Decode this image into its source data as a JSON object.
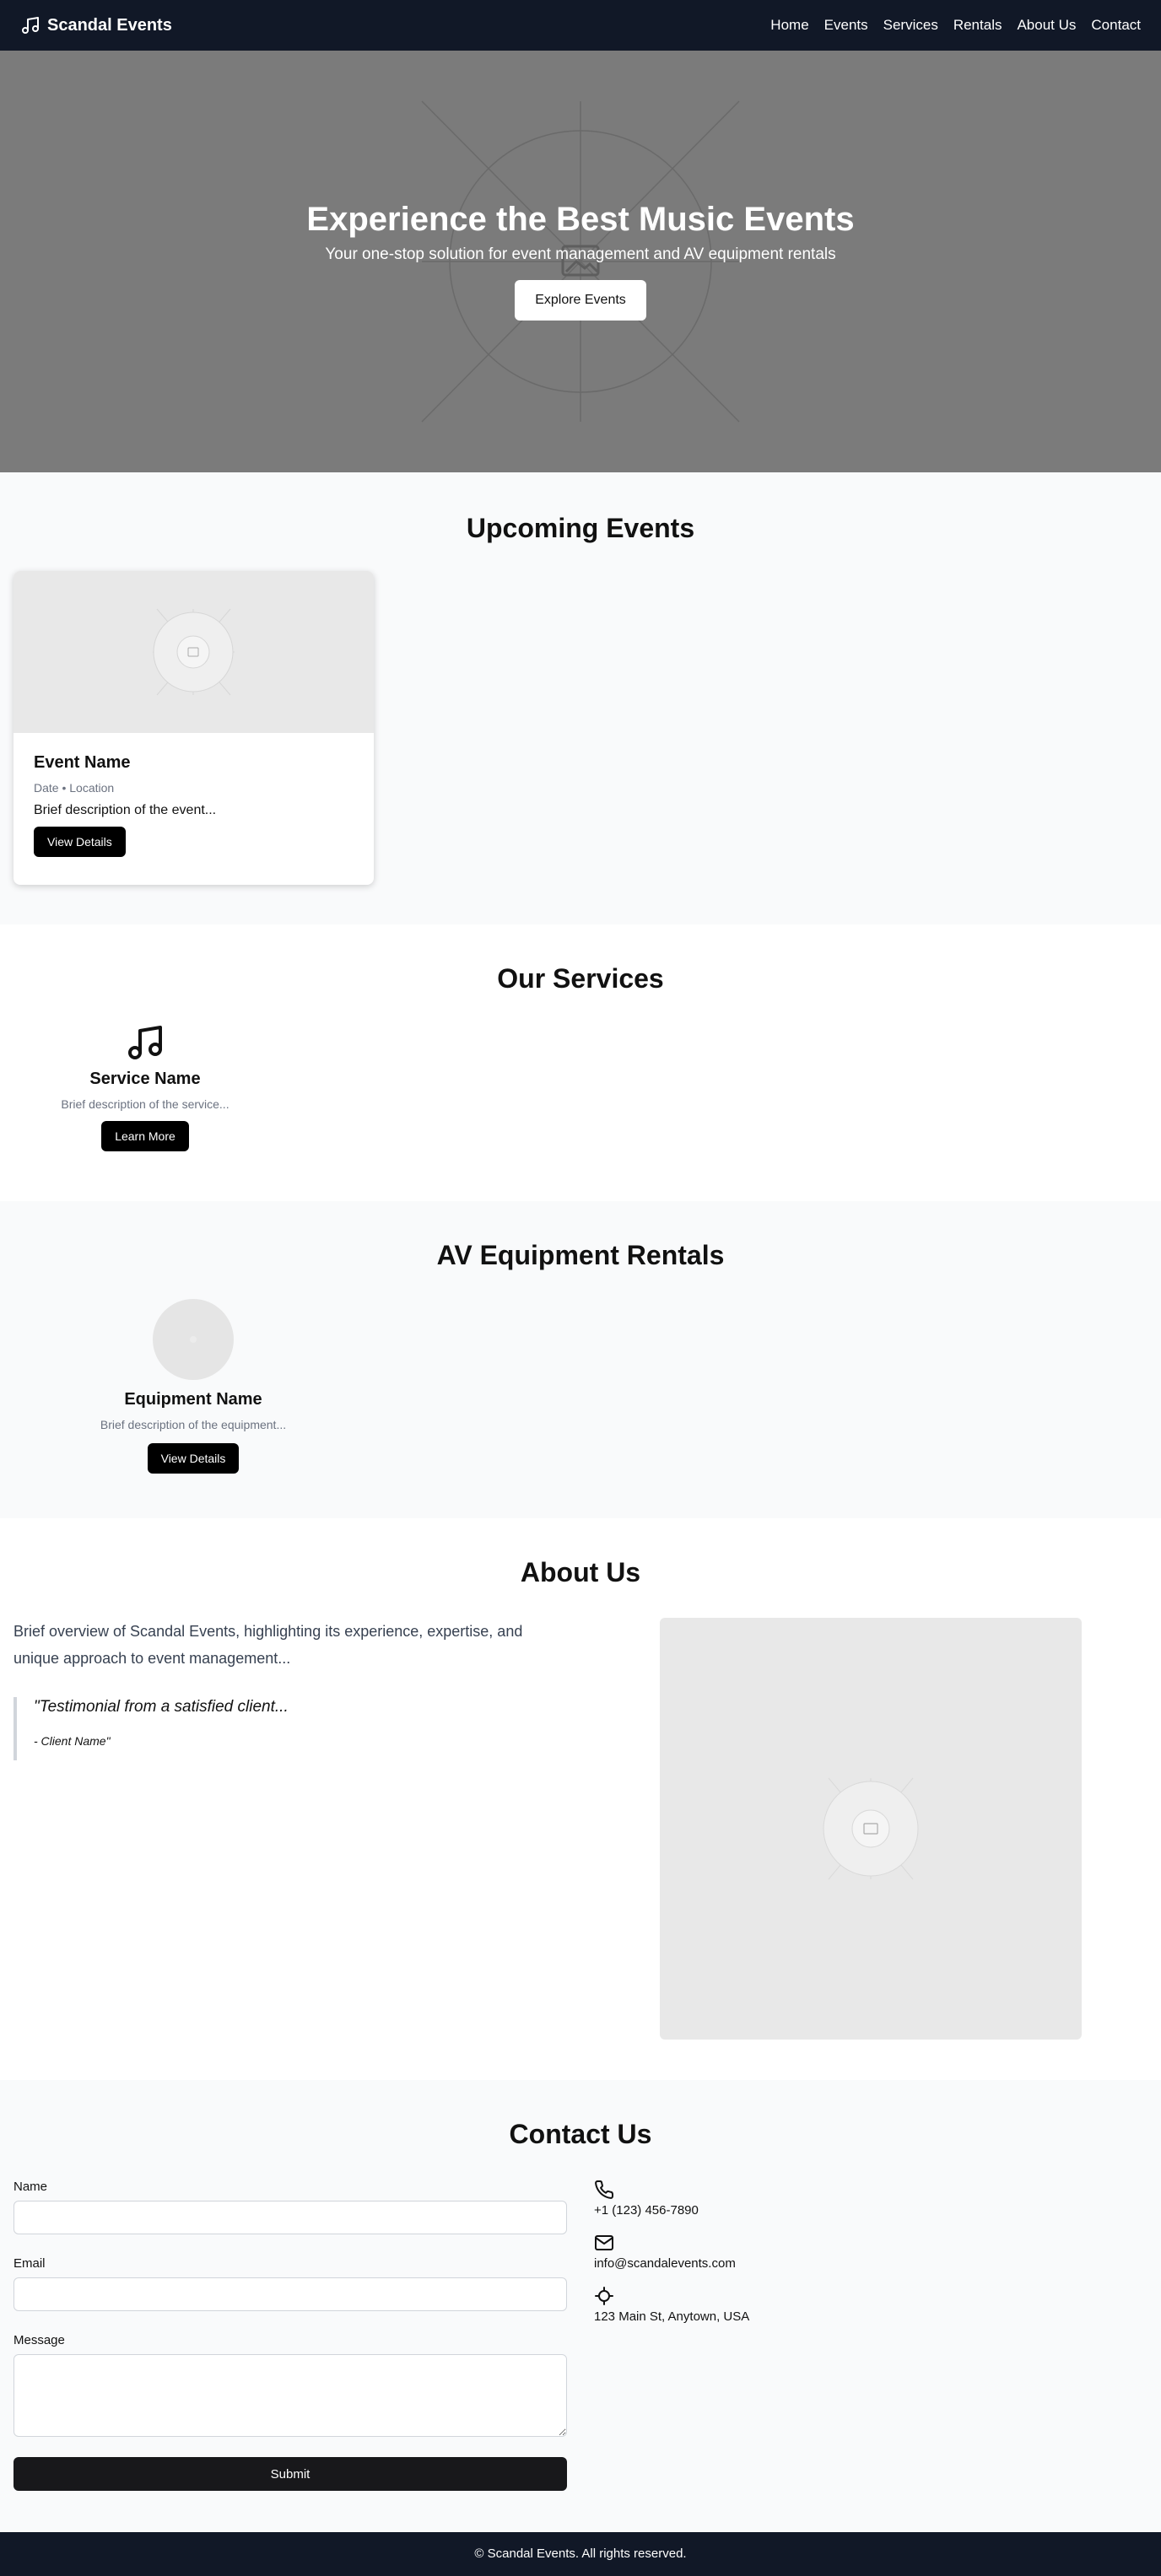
{
  "nav": {
    "brand": "Scandal Events",
    "links": [
      "Home",
      "Events",
      "Services",
      "Rentals",
      "About Us",
      "Contact"
    ]
  },
  "hero": {
    "title": "Experience the Best Music Events",
    "subtitle": "Your one-stop solution for event management and AV equipment rentals",
    "cta": "Explore Events"
  },
  "events": {
    "title": "Upcoming Events",
    "items": [
      {
        "name": "Event Name",
        "meta": "Date • Location",
        "description": "Brief description of the event...",
        "button": "View Details"
      }
    ]
  },
  "services": {
    "title": "Our Services",
    "items": [
      {
        "icon": "music-note-icon",
        "name": "Service Name",
        "description": "Brief description of the service...",
        "button": "Learn More"
      }
    ]
  },
  "rentals": {
    "title": "AV Equipment Rentals",
    "items": [
      {
        "name": "Equipment Name",
        "description": "Brief description of the equipment...",
        "button": "View Details"
      }
    ]
  },
  "about": {
    "title": "About Us",
    "text": "Brief overview of Scandal Events, highlighting its experience, expertise, and unique approach to event management...",
    "testimonial": "\"Testimonial from a satisfied client...",
    "author": "- Client Name\""
  },
  "contact": {
    "title": "Contact Us",
    "name_label": "Name",
    "email_label": "Email",
    "message_label": "Message",
    "name_value": "",
    "email_value": "",
    "message_value": "",
    "submit": "Submit",
    "phone": "+1 (123) 456-7890",
    "email": "info@scandalevents.com",
    "address": "123 Main St, Anytown, USA"
  },
  "footer": {
    "text": "© Scandal Events. All rights reserved."
  },
  "colors": {
    "nav_bg": "#111827",
    "hero_bg": "#7b7b7b",
    "section_alt_bg": "#f9fafb",
    "button_dark": "#000000"
  }
}
